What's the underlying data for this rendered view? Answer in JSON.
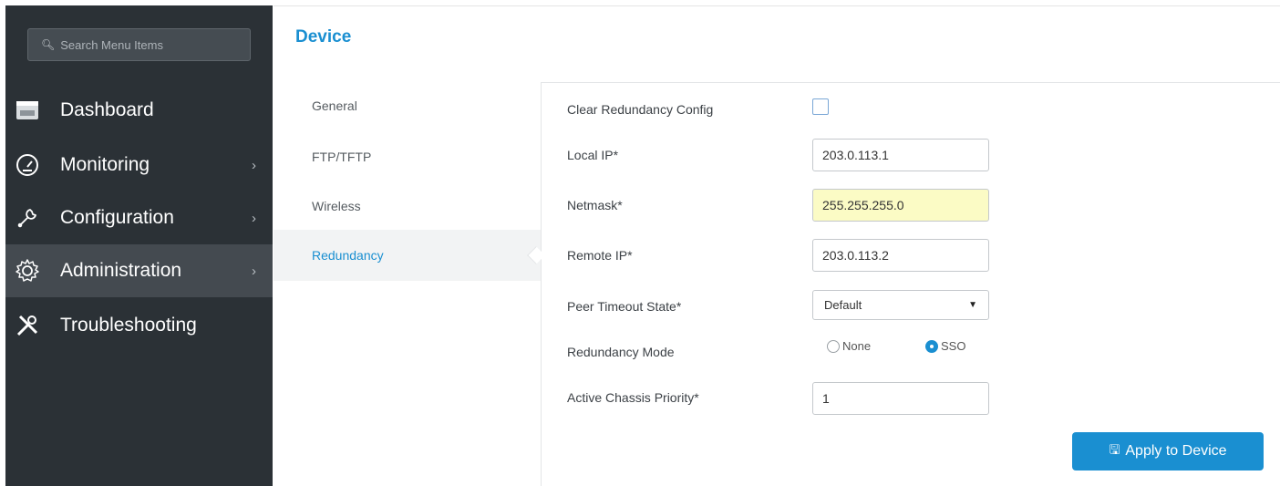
{
  "sidebar": {
    "search_placeholder": "Search Menu Items",
    "items": [
      {
        "label": "Dashboard",
        "icon": "dashboard-icon",
        "has_chevron": false
      },
      {
        "label": "Monitoring",
        "icon": "gauge-icon",
        "has_chevron": true
      },
      {
        "label": "Configuration",
        "icon": "wrench-icon",
        "has_chevron": true
      },
      {
        "label": "Administration",
        "icon": "gear-icon",
        "has_chevron": true,
        "active": true
      },
      {
        "label": "Troubleshooting",
        "icon": "tools-icon",
        "has_chevron": false
      }
    ]
  },
  "page": {
    "title": "Device"
  },
  "tabs": [
    {
      "label": "General"
    },
    {
      "label": "FTP/TFTP"
    },
    {
      "label": "Wireless"
    },
    {
      "label": "Redundancy",
      "active": true
    }
  ],
  "form": {
    "clear_config_label": "Clear Redundancy Config",
    "clear_config_checked": false,
    "local_ip_label": "Local IP*",
    "local_ip_value": "203.0.113.1",
    "netmask_label": "Netmask*",
    "netmask_value": "255.255.255.0",
    "remote_ip_label": "Remote IP*",
    "remote_ip_value": "203.0.113.2",
    "peer_timeout_label": "Peer Timeout State*",
    "peer_timeout_value": "Default",
    "mode_label": "Redundancy Mode",
    "mode_options": [
      "None",
      "SSO"
    ],
    "mode_selected": "SSO",
    "priority_label": "Active Chassis Priority*",
    "priority_value": "1"
  },
  "actions": {
    "apply_label": "Apply to Device"
  },
  "colors": {
    "accent": "#1a8fd1",
    "sidebar_bg": "#2b3136",
    "highlight_field": "#fbfbc5"
  }
}
